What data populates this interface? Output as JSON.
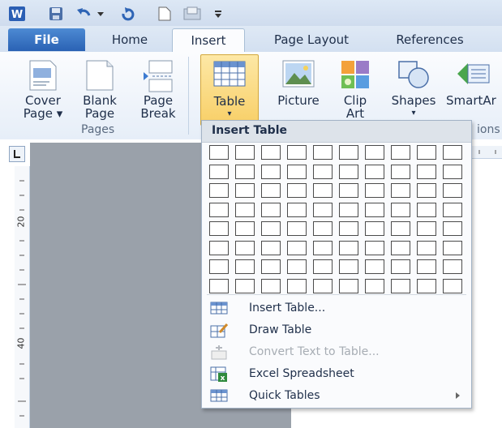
{
  "tabs": [
    {
      "label": "File"
    },
    {
      "label": "Home"
    },
    {
      "label": "Insert"
    },
    {
      "label": "Page Layout"
    },
    {
      "label": "References"
    }
  ],
  "ribbon": {
    "cover_page": {
      "line1": "Cover",
      "line2": "Page ▾"
    },
    "blank_page": {
      "line1": "Blank",
      "line2": "Page"
    },
    "page_break": {
      "line1": "Page",
      "line2": "Break"
    },
    "table": {
      "line1": "Table",
      "line2": "▾"
    },
    "picture": {
      "line1": "Picture"
    },
    "clip_art": {
      "line1": "Clip",
      "line2": "Art"
    },
    "shapes": {
      "line1": "Shapes",
      "line2": "▾"
    },
    "smartart": {
      "line1": "SmartAr"
    },
    "pages_group": "Pages",
    "illustrations_group_fragment": "ions"
  },
  "ruler": {
    "mark_20": "20",
    "mark_40": "40"
  },
  "menu": {
    "header": "Insert Table",
    "grid_cols": 10,
    "grid_rows": 8,
    "items": [
      {
        "label": "Insert Table...",
        "disabled": false,
        "submenu": false
      },
      {
        "label": "Draw Table",
        "disabled": false,
        "submenu": false
      },
      {
        "label": "Convert Text to Table...",
        "disabled": true,
        "submenu": false
      },
      {
        "label": "Excel Spreadsheet",
        "disabled": false,
        "submenu": false
      },
      {
        "label": "Quick Tables",
        "disabled": false,
        "submenu": true
      }
    ]
  }
}
